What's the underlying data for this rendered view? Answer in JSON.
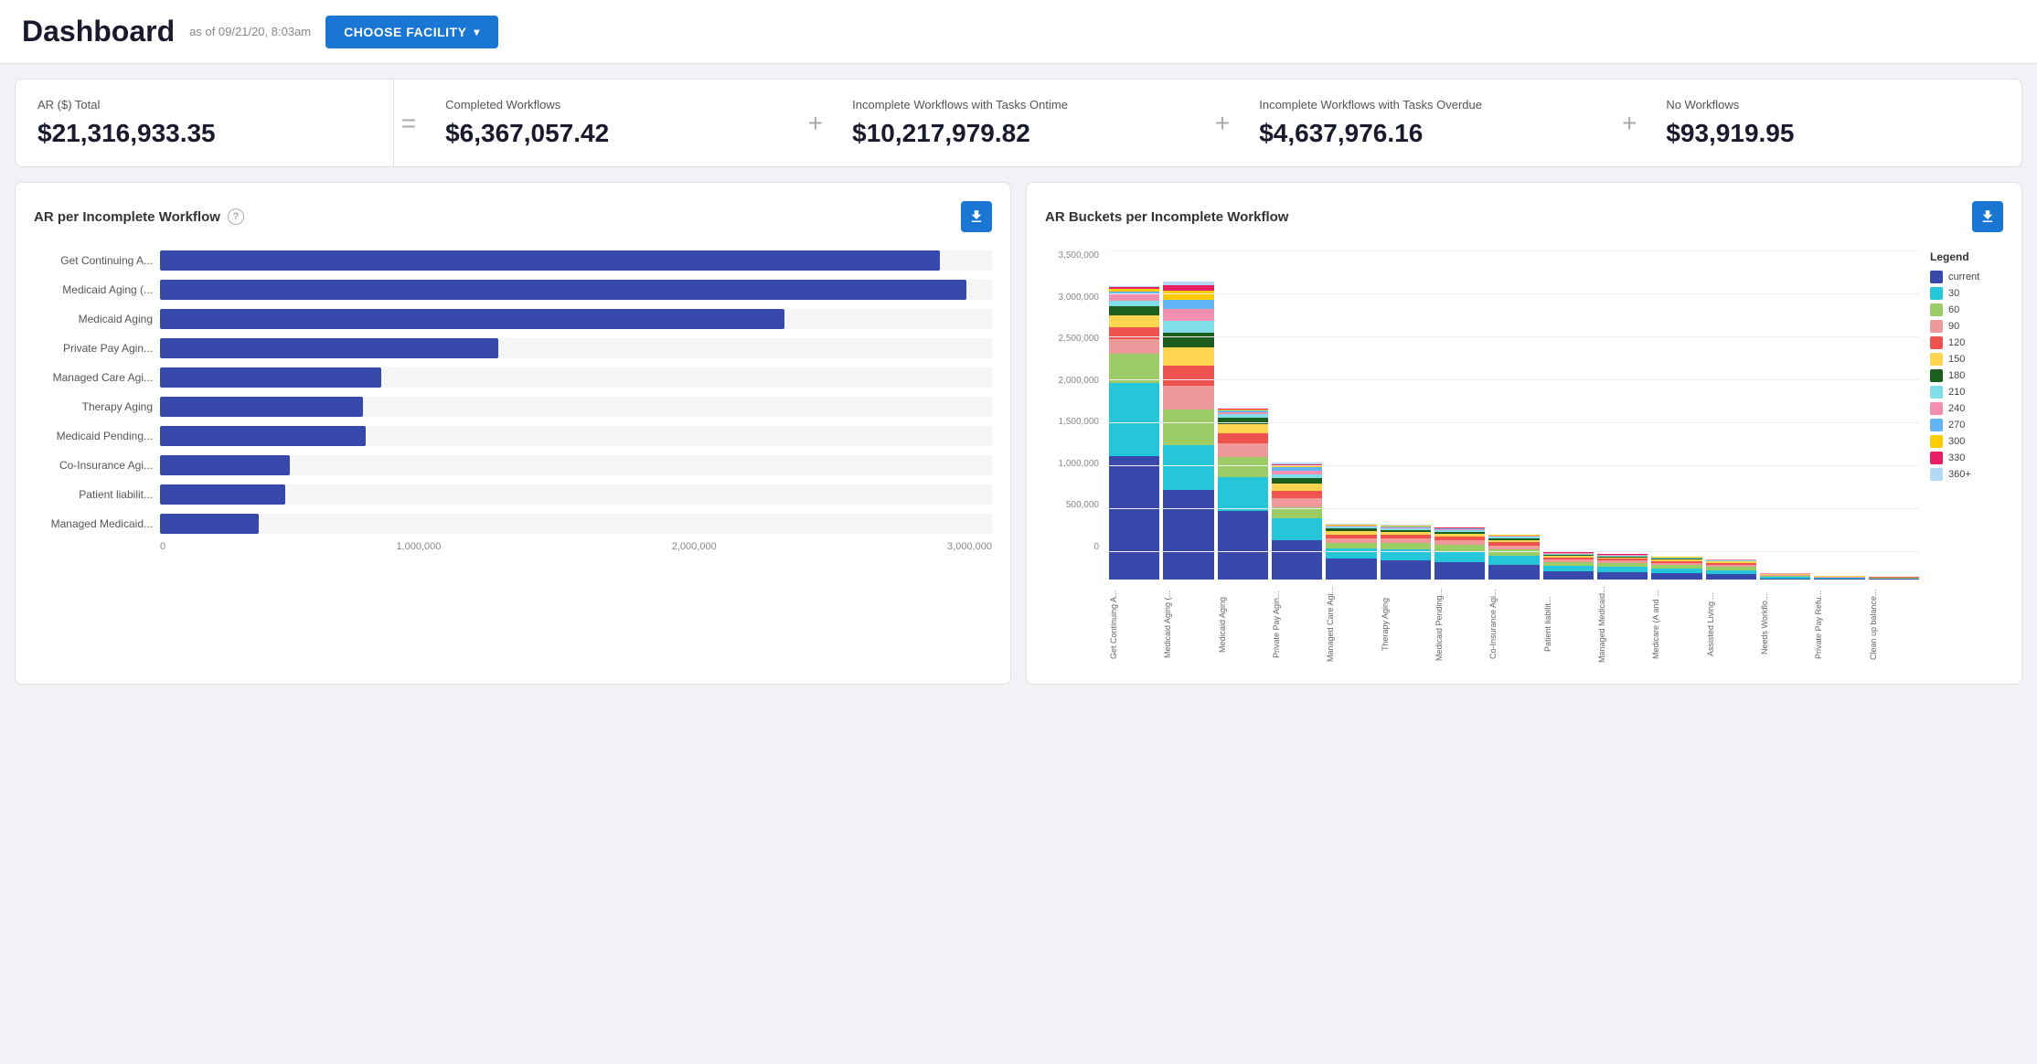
{
  "header": {
    "title": "Dashboard",
    "subtitle": "as of 09/21/20, 8:03am",
    "choose_facility_label": "CHOOSE FACILITY"
  },
  "metrics": [
    {
      "label": "AR ($) Total",
      "value": "$21,316,933.35",
      "separator": "="
    },
    {
      "label": "Completed Workflows",
      "value": "$6,367,057.42",
      "separator": "+"
    },
    {
      "label": "Incomplete Workflows with Tasks Ontime",
      "value": "$10,217,979.82",
      "separator": "+"
    },
    {
      "label": "Incomplete Workflows with Tasks Overdue",
      "value": "$4,637,976.16",
      "separator": "+"
    },
    {
      "label": "No Workflows",
      "value": "$93,919.95",
      "separator": null
    }
  ],
  "bar_chart": {
    "title": "AR per Incomplete Workflow",
    "bars": [
      {
        "label": "Get Continuing A...",
        "value": 3000000,
        "max": 3200000
      },
      {
        "label": "Medicaid Aging (...",
        "value": 3100000,
        "max": 3200000
      },
      {
        "label": "Medicaid Aging",
        "value": 2400000,
        "max": 3200000
      },
      {
        "label": "Private Pay Agin...",
        "value": 1300000,
        "max": 3200000
      },
      {
        "label": "Managed Care Agi...",
        "value": 850000,
        "max": 3200000
      },
      {
        "label": "Therapy Aging",
        "value": 780000,
        "max": 3200000
      },
      {
        "label": "Medicaid Pending...",
        "value": 790000,
        "max": 3200000
      },
      {
        "label": "Co-Insurance Agi...",
        "value": 500000,
        "max": 3200000
      },
      {
        "label": "Patient liabilit...",
        "value": 480000,
        "max": 3200000
      },
      {
        "label": "Managed Medicaid...",
        "value": 380000,
        "max": 3200000
      }
    ],
    "x_labels": [
      "0",
      "1,000,000",
      "2,000,000",
      "3,000,000"
    ]
  },
  "stacked_chart": {
    "title": "AR Buckets per Incomplete Workflow",
    "y_labels": [
      "3,500,000",
      "3,000,000",
      "2,500,000",
      "2,000,000",
      "1,500,000",
      "1,000,000",
      "500,000",
      "0"
    ],
    "x_labels": [
      "Get Continuing A...",
      "Medicaid Aging (...",
      "Medicaid Aging",
      "Private Pay Agin...",
      "Managed Care Agi...",
      "Therapy Aging",
      "Medicaid Pending...",
      "Co-Insurance Agi...",
      "Patient liabilit...",
      "Managed Medicaid...",
      "Medicare (A and ...",
      "Assisted Living ...",
      "Needs Workflo...",
      "Private Pay Refu...",
      "Clean up balance..."
    ],
    "legend": [
      {
        "label": "current",
        "color": "#3949ab"
      },
      {
        "label": "30",
        "color": "#26c6da"
      },
      {
        "label": "60",
        "color": "#9ccc65"
      },
      {
        "label": "90",
        "color": "#ef9a9a"
      },
      {
        "label": "120",
        "color": "#ef5350"
      },
      {
        "label": "150",
        "color": "#ffd54f"
      },
      {
        "label": "180",
        "color": "#1b5e20"
      },
      {
        "label": "210",
        "color": "#80deea"
      },
      {
        "label": "240",
        "color": "#f48fb1"
      },
      {
        "label": "270",
        "color": "#64b5f6"
      },
      {
        "label": "300",
        "color": "#ffcc02"
      },
      {
        "label": "330",
        "color": "#e91e63"
      },
      {
        "label": "360+",
        "color": "#b3d9f7"
      }
    ],
    "bars": [
      {
        "total": 3700000,
        "segments": [
          0.42,
          0.25,
          0.1,
          0.05,
          0.04,
          0.04,
          0.03,
          0.02,
          0.02,
          0.01,
          0.01,
          0.005,
          0.005
        ]
      },
      {
        "total": 3750000,
        "segments": [
          0.3,
          0.15,
          0.12,
          0.08,
          0.07,
          0.06,
          0.05,
          0.04,
          0.04,
          0.03,
          0.03,
          0.02,
          0.01
        ]
      },
      {
        "total": 2150000,
        "segments": [
          0.4,
          0.2,
          0.12,
          0.08,
          0.06,
          0.05,
          0.04,
          0.02,
          0.01,
          0.01,
          0.005,
          0.005,
          0.005
        ]
      },
      {
        "total": 1400000,
        "segments": [
          0.35,
          0.2,
          0.1,
          0.08,
          0.07,
          0.06,
          0.05,
          0.04,
          0.03,
          0.03,
          0.02,
          0.01,
          0.01
        ]
      },
      {
        "total": 700000,
        "segments": [
          0.38,
          0.18,
          0.1,
          0.08,
          0.07,
          0.06,
          0.05,
          0.03,
          0.02,
          0.01,
          0.01,
          0.005,
          0.005
        ]
      },
      {
        "total": 680000,
        "segments": [
          0.36,
          0.2,
          0.12,
          0.08,
          0.07,
          0.05,
          0.04,
          0.03,
          0.02,
          0.02,
          0.01,
          0.005,
          0.005
        ]
      },
      {
        "total": 650000,
        "segments": [
          0.34,
          0.2,
          0.13,
          0.09,
          0.07,
          0.05,
          0.04,
          0.03,
          0.02,
          0.02,
          0.01,
          0.005,
          0.005
        ]
      },
      {
        "total": 560000,
        "segments": [
          0.32,
          0.22,
          0.13,
          0.1,
          0.07,
          0.05,
          0.04,
          0.03,
          0.02,
          0.01,
          0.01,
          0.005,
          0.005
        ]
      },
      {
        "total": 340000,
        "segments": [
          0.3,
          0.22,
          0.14,
          0.1,
          0.07,
          0.06,
          0.04,
          0.03,
          0.02,
          0.01,
          0.01,
          0.005,
          0.005
        ]
      },
      {
        "total": 320000,
        "segments": [
          0.28,
          0.22,
          0.14,
          0.1,
          0.08,
          0.06,
          0.04,
          0.03,
          0.02,
          0.01,
          0.01,
          0.005,
          0.005
        ]
      },
      {
        "total": 290000,
        "segments": [
          0.26,
          0.22,
          0.15,
          0.1,
          0.08,
          0.06,
          0.04,
          0.03,
          0.02,
          0.01,
          0.01,
          0.01,
          0.005
        ]
      },
      {
        "total": 260000,
        "segments": [
          0.25,
          0.2,
          0.15,
          0.12,
          0.09,
          0.06,
          0.04,
          0.03,
          0.02,
          0.01,
          0.01,
          0.01,
          0.005
        ]
      },
      {
        "total": 80000,
        "segments": [
          0.2,
          0.2,
          0.15,
          0.12,
          0.1,
          0.08,
          0.05,
          0.04,
          0.02,
          0.01,
          0.01,
          0.01,
          0.01
        ]
      },
      {
        "total": 50000,
        "segments": [
          0.2,
          0.2,
          0.15,
          0.12,
          0.1,
          0.08,
          0.05,
          0.04,
          0.02,
          0.01,
          0.01,
          0.01,
          0.01
        ]
      },
      {
        "total": 40000,
        "segments": [
          0.2,
          0.2,
          0.15,
          0.12,
          0.1,
          0.08,
          0.05,
          0.04,
          0.02,
          0.01,
          0.01,
          0.01,
          0.01
        ]
      }
    ]
  }
}
